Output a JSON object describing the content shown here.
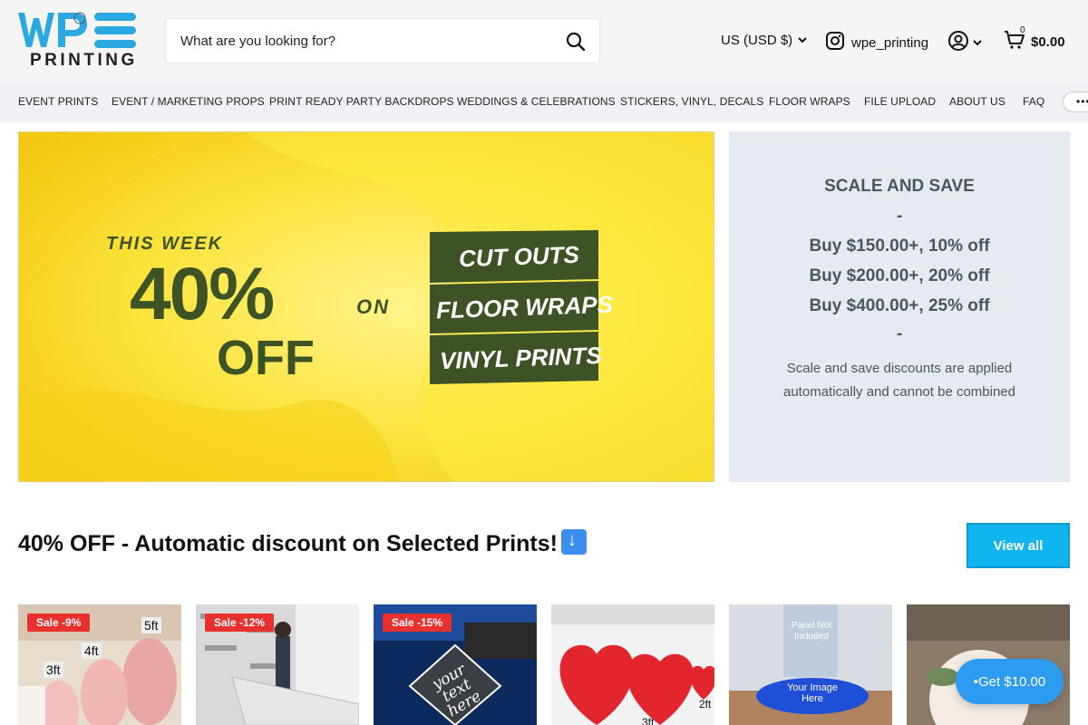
{
  "header": {
    "logo_text": "PRINTING",
    "search_placeholder": "What are you looking for?",
    "currency": "US (USD $)",
    "instagram_handle": "wpe_printing",
    "cart_count": "0",
    "cart_total": "$0.00"
  },
  "nav": {
    "items": [
      "EVENT PRINTS",
      "EVENT / MARKETING PROPS",
      "PRINT READY PARTY BACKDROPS",
      "WEDDINGS & CELEBRATIONS",
      "STICKERS, VINYL, DECALS",
      "FLOOR WRAPS",
      "FILE UPLOAD",
      "ABOUT US",
      "FAQ"
    ],
    "more_label": "•••"
  },
  "hero": {
    "kicker": "THIS WEEK",
    "big": "40%",
    "off": "OFF",
    "on": "ON",
    "tags": [
      "CUT OUTS",
      "FLOOR WRAPS",
      "VINYL PRINTS"
    ]
  },
  "promo": {
    "title": "SCALE AND SAVE",
    "dash": "-",
    "tiers": [
      "Buy $150.00+, 10% off",
      "Buy $200.00+, 20% off",
      "Buy $400.00+, 25% off"
    ],
    "note": "Scale and save discounts are applied automatically and cannot be combined"
  },
  "section": {
    "title": "40% OFF - Automatic discount on Selected Prints!",
    "view_all": "View all"
  },
  "products": [
    {
      "badge": "Sale -9%",
      "labels": [
        "5ft",
        "4ft",
        "3ft"
      ]
    },
    {
      "badge": "Sale -12%"
    },
    {
      "badge": "Sale -15%",
      "overlay": "your text here"
    },
    {
      "labels": [
        "2ft",
        "3ft"
      ]
    },
    {
      "overlay_top": "Panel Not Included",
      "overlay": "Your Image Here"
    },
    {}
  ],
  "get_reward": "Get $10.00",
  "colors": {
    "brand_blue": "#2d9cf0",
    "view_all_bg": "#10b5ef",
    "sale_red": "#e8312f",
    "hero_yellow": "#fde327",
    "hero_green": "#3d5225"
  }
}
